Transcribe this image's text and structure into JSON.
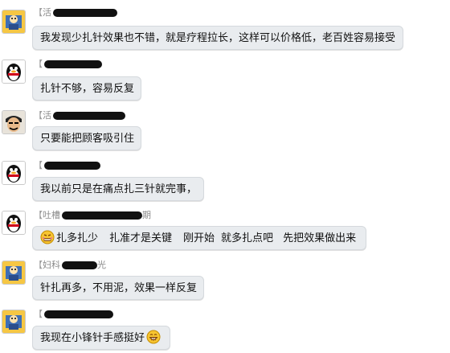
{
  "chat": {
    "messages": [
      {
        "sender_prefix": "【",
        "sender_visible": "活",
        "avatar": "yellow-character-avatar-icon",
        "text": "我发现少扎针效果也不错，就是疗程拉长，这样可以价格低，老百姓容易接受"
      },
      {
        "sender_prefix": "【",
        "sender_visible": "",
        "avatar": "penguin-avatar-icon",
        "text": "扎针不够，容易反复"
      },
      {
        "sender_prefix": "【",
        "sender_visible": "活",
        "avatar": "samurai-avatar-icon",
        "text": "只要能把顾客吸引住"
      },
      {
        "sender_prefix": "【",
        "sender_visible": "",
        "avatar": "penguin-avatar-icon",
        "text": "我以前只是在痛点扎三针就完事，"
      },
      {
        "sender_prefix": "【",
        "sender_visible": "吐槽",
        "sender_tail": "期",
        "avatar": "penguin-avatar-icon",
        "emoji": "grimace-emoji-icon",
        "text_parts": [
          "扎多扎少",
          "扎准才是关键",
          "刚开始",
          "就多扎点吧",
          "先把效果做出来"
        ]
      },
      {
        "sender_prefix": "【",
        "sender_visible": "妇科",
        "sender_tail": "光",
        "avatar": "yellow-character-avatar-icon",
        "text": "针扎再多，不用泥，效果一样反复"
      },
      {
        "sender_prefix": "【",
        "sender_visible": "",
        "avatar": "yellow-character-avatar-icon",
        "text": "我现在小锋针手感挺好",
        "emoji_after": "grin-emoji-icon"
      }
    ]
  }
}
